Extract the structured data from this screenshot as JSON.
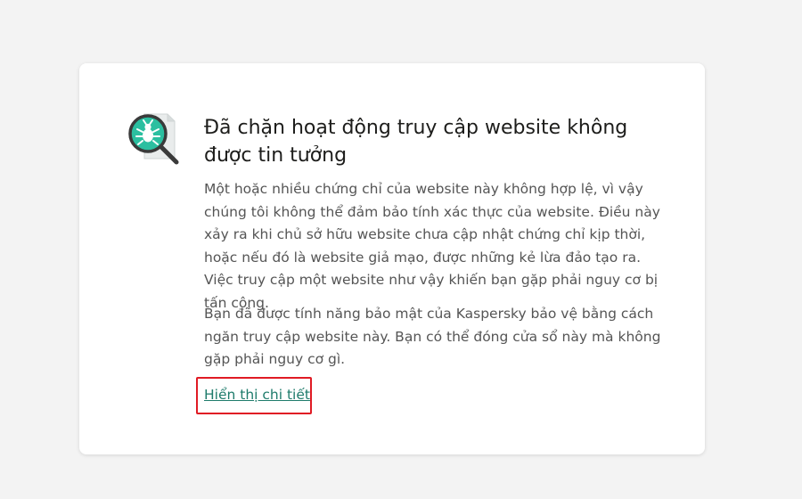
{
  "page": {
    "title": "Đã chặn hoạt động truy cập website không được tin tưởng",
    "paragraph1": "Một hoặc nhiều chứng chỉ của website này không hợp lệ, vì vậy chúng tôi không thể đảm bảo tính xác thực của website. Điều này xảy ra khi chủ sở hữu website chưa cập nhật chứng chỉ kịp thời, hoặc nếu đó là website giả mạo, được những kẻ lừa đảo tạo ra. Việc truy cập một website như vậy khiến bạn gặp phải nguy cơ bị tấn công.",
    "paragraph2": "Bạn đã được tính năng bảo mật của Kaspersky bảo vệ bằng cách ngăn truy cập website này. Bạn có thể đóng cửa sổ này mà không gặp phải nguy cơ gì.",
    "details_link": "Hiển thị chi tiết"
  },
  "icons": {
    "warning": "magnifier-bug-icon"
  },
  "colors": {
    "accent": "#1e7b6b",
    "icon_teal": "#2bbfa0",
    "highlight": "#e01b24"
  }
}
